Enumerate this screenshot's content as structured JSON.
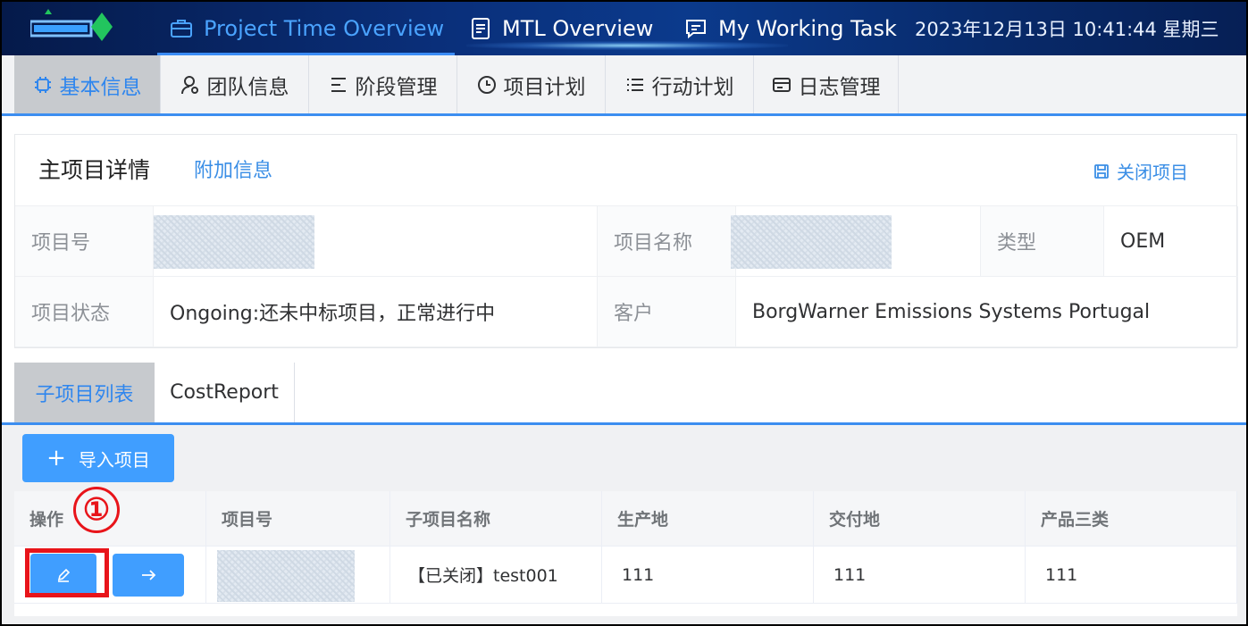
{
  "topnav": {
    "items": [
      {
        "label": "Project Time Overview",
        "icon": "briefcase-icon",
        "active": true
      },
      {
        "label": "MTL Overview",
        "icon": "document-icon",
        "active": false
      },
      {
        "label": "My Working Task",
        "icon": "chat-icon",
        "active": false
      }
    ],
    "datetime": "2023年12月13日 10:41:44 星期三"
  },
  "tabs": [
    {
      "label": "基本信息",
      "icon": "chip-icon",
      "active": true
    },
    {
      "label": "团队信息",
      "icon": "user-icon",
      "active": false
    },
    {
      "label": "阶段管理",
      "icon": "stages-icon",
      "active": false
    },
    {
      "label": "项目计划",
      "icon": "clock-icon",
      "active": false
    },
    {
      "label": "行动计划",
      "icon": "list-icon",
      "active": false
    },
    {
      "label": "日志管理",
      "icon": "card-icon",
      "active": false
    }
  ],
  "detail": {
    "title": "主项目详情",
    "extra_link": "附加信息",
    "close_action": "关闭项目",
    "fields": {
      "project_no_label": "项目号",
      "project_name_label": "项目名称",
      "type_label": "类型",
      "type_value": "OEM",
      "status_label": "项目状态",
      "status_value": "Ongoing:还未中标项目，正常进行中",
      "customer_label": "客户",
      "customer_value": "BorgWarner Emissions Systems Portugal"
    }
  },
  "subtabs": [
    {
      "label": "子项目列表",
      "active": true
    },
    {
      "label": "CostReport",
      "active": false
    }
  ],
  "list": {
    "import_label": "导入项目",
    "columns": [
      "操作",
      "项目号",
      "子项目名称",
      "生产地",
      "交付地",
      "产品三类"
    ],
    "rows": [
      {
        "name": "【已关闭】test001",
        "production": "111",
        "delivery": "111",
        "category": "111"
      }
    ]
  },
  "annotation": {
    "step_marker": "①",
    "color": "#e8141a"
  },
  "colors": {
    "accent": "#409eff",
    "nav_bg": "#0a2f7a",
    "active_tab_bg": "#c7cace"
  }
}
